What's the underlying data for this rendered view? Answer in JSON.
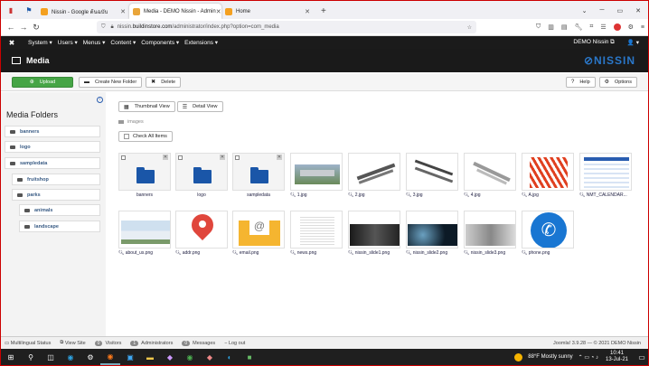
{
  "browser": {
    "tabs": [
      {
        "label": "Nissin - Google ต้นฉบับ",
        "color": "#1a73e8"
      },
      {
        "label": "Media - DEMO Nissin - Admin",
        "color": "#1e3f7a",
        "active": true
      },
      {
        "label": "Home",
        "color": "#f4a020"
      }
    ],
    "url_prefix": "nissin.",
    "url_host": "buildinstore.com",
    "url_path": "/administrator/index.php?option=com_media"
  },
  "joomla": {
    "menus": [
      "System ▾",
      "Users ▾",
      "Menus ▾",
      "Content ▾",
      "Components ▾",
      "Extensions ▾"
    ],
    "site_link": "DEMO Nissin ⧉",
    "user_menu": "👤 ▾",
    "page_title": "Media",
    "brand": "⊘NISSIN"
  },
  "toolbar": {
    "upload": "Upload",
    "new_folder": "Create New Folder",
    "delete": "Delete",
    "help": "Help",
    "options": "Options"
  },
  "sidebar": {
    "title": "Media Folders",
    "folders": [
      "banners",
      "logo",
      "sampledata",
      "fruitshop",
      "parks",
      "animals",
      "landscape"
    ]
  },
  "content": {
    "thumbnail_view": "Thumbnail View",
    "detail_view": "Detail View",
    "breadcrumb": "images",
    "check_all": "Check All Items",
    "folders": [
      "banners",
      "logo",
      "sampledata"
    ],
    "images_row1": [
      "1.jpg",
      "2.jpg",
      "3.jpg",
      "4.jpg",
      "A.jpg",
      "NMT_CALENDAR..."
    ],
    "images_row2": [
      "about_us.png",
      "addr.png",
      "email.png",
      "news.png",
      "nissin_slide1.png",
      "nissin_slide2.png",
      "nissin_slide3.png",
      "phone.png"
    ]
  },
  "footer": {
    "multilingual": "Multilingual Status",
    "view_site": "View Site",
    "visitors_count": "0",
    "visitors": "Visitors",
    "admins_count": "1",
    "admins": "Administrators",
    "messages_count": "0",
    "messages": "Messages",
    "logout": "Log out",
    "version": "Joomla! 3.9.28 — © 2021 DEMO Nissin"
  },
  "taskbar": {
    "weather": "88°F  Mostly sunny",
    "time": "10:41",
    "date": "13-Jul-21"
  }
}
